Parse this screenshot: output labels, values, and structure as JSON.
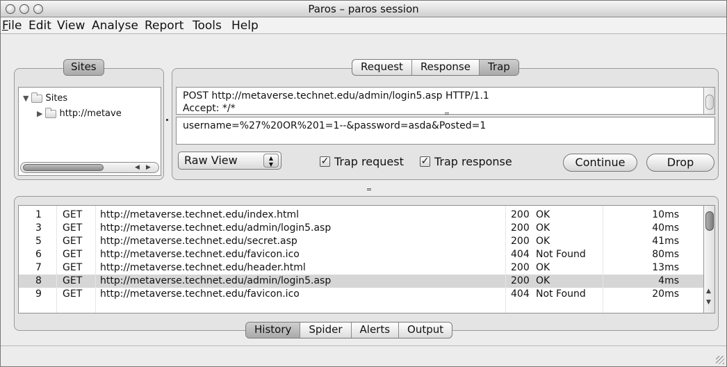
{
  "window": {
    "title": "Paros – paros session"
  },
  "menu": [
    {
      "label": "File",
      "underline": "F",
      "rest": "ile"
    },
    {
      "label": "Edit"
    },
    {
      "label": "View"
    },
    {
      "label": "Analyse"
    },
    {
      "label": "Report"
    },
    {
      "label": "Tools"
    },
    {
      "label": "Help"
    }
  ],
  "sites": {
    "tab_label": "Sites",
    "root_label": "Sites",
    "child_label": "http://metave"
  },
  "request_tabs": [
    {
      "label": "Request",
      "active": false
    },
    {
      "label": "Response",
      "active": false
    },
    {
      "label": "Trap",
      "active": true
    }
  ],
  "trap": {
    "header_line1": "POST http://metaverse.technet.edu/admin/login5.asp HTTP/1.1",
    "header_line2": "Accept: */*",
    "body": "username=%27%20OR%201=1--&password=asda&Posted=1",
    "view_select": "Raw View",
    "trap_request_label": "Trap request",
    "trap_request_checked": true,
    "trap_response_label": "Trap response",
    "trap_response_checked": true,
    "continue_label": "Continue",
    "drop_label": "Drop"
  },
  "history": {
    "rows": [
      {
        "id": "1",
        "method": "GET",
        "url": "http://metaverse.technet.edu/index.html",
        "code": "200",
        "status": "OK",
        "time": "10ms",
        "selected": false
      },
      {
        "id": "3",
        "method": "GET",
        "url": "http://metaverse.technet.edu/admin/login5.asp",
        "code": "200",
        "status": "OK",
        "time": "40ms",
        "selected": false
      },
      {
        "id": "5",
        "method": "GET",
        "url": "http://metaverse.technet.edu/secret.asp",
        "code": "200",
        "status": "OK",
        "time": "41ms",
        "selected": false
      },
      {
        "id": "6",
        "method": "GET",
        "url": "http://metaverse.technet.edu/favicon.ico",
        "code": "404",
        "status": "Not Found",
        "time": "80ms",
        "selected": false
      },
      {
        "id": "7",
        "method": "GET",
        "url": "http://metaverse.technet.edu/header.html",
        "code": "200",
        "status": "OK",
        "time": "13ms",
        "selected": false
      },
      {
        "id": "8",
        "method": "GET",
        "url": "http://metaverse.technet.edu/admin/login5.asp",
        "code": "200",
        "status": "OK",
        "time": "4ms",
        "selected": true
      },
      {
        "id": "9",
        "method": "GET",
        "url": "http://metaverse.technet.edu/favicon.ico",
        "code": "404",
        "status": "Not Found",
        "time": "20ms",
        "selected": false
      }
    ]
  },
  "bottom_tabs": [
    {
      "label": "History",
      "active": true
    },
    {
      "label": "Spider",
      "active": false
    },
    {
      "label": "Alerts",
      "active": false
    },
    {
      "label": "Output",
      "active": false
    }
  ]
}
